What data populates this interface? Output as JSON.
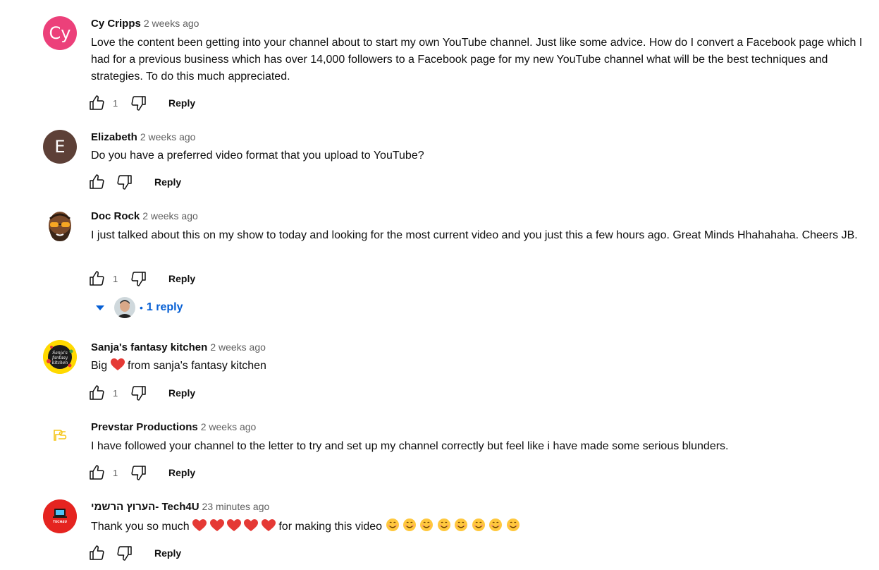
{
  "comments": [
    {
      "author": "Cy Cripps",
      "time": "2 weeks ago",
      "avatar": {
        "text": "Cy",
        "color": "#ec407a"
      },
      "text": "Love the content been getting into your channel about to start my own YouTube channel. Just like some advice. How do I convert a Facebook page which I had for a previous business which has over 14,000 followers to a Facebook page for my new YouTube channel what will be the best techniques and strategies. To do this much appreciated.",
      "likes": "1",
      "reply_label": "Reply"
    },
    {
      "author": "Elizabeth",
      "time": "2 weeks ago",
      "avatar": {
        "text": "E",
        "color": "#5d4037"
      },
      "text": "Do you have a preferred video format that you upload to YouTube?",
      "likes": "",
      "reply_label": "Reply"
    },
    {
      "author": "Doc Rock",
      "time": "2 weeks ago",
      "avatar": {
        "icon": "bearded-man-sunglasses-avatar"
      },
      "text": "I just talked about this on my show to today and looking for the most current video and you just this a few hours ago. Great Minds Hhahahaha. Cheers JB.",
      "likes": "1",
      "reply_label": "Reply",
      "replies": {
        "label": "1 reply"
      }
    },
    {
      "author": "Sanja's fantasy kitchen",
      "time": "2 weeks ago",
      "avatar": {
        "icon": "fantasy-kitchen-logo",
        "logo_text": "Sanja's fantasy kitchen"
      },
      "text_before": "Big",
      "text_after": "from sanja's fantasy kitchen",
      "likes": "1",
      "reply_label": "Reply"
    },
    {
      "author": "Prevstar Productions",
      "time": "2 weeks ago",
      "avatar": {
        "icon": "ps-logo"
      },
      "text": "I have followed your channel to the letter to try and set up my channel correctly but feel like i have made some serious blunders.",
      "likes": "1",
      "reply_label": "Reply"
    },
    {
      "author": "הערוץ הרשמי- Tech4U",
      "time": "23 minutes ago",
      "avatar": {
        "icon": "tech4u-logo",
        "logo_text": "TECH4U",
        "color": "#e52420"
      },
      "text_before": "Thank you so much",
      "text_middle": "for making this video",
      "likes": "",
      "reply_label": "Reply"
    }
  ],
  "colors": {
    "link_blue": "#065fd4",
    "secondary_text": "#606060",
    "heart": "#e53935",
    "smiley": "#ffc83d"
  }
}
